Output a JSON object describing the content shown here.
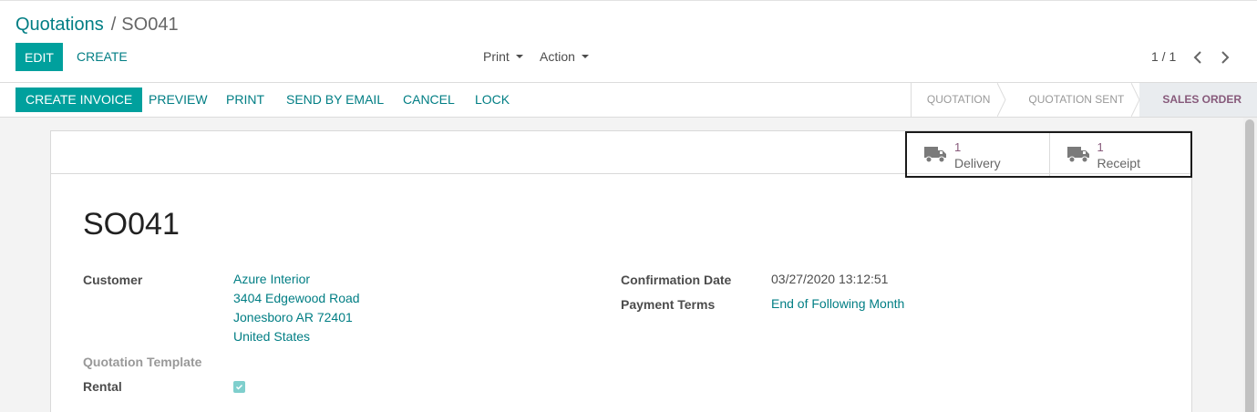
{
  "breadcrumb": {
    "parent": "Quotations",
    "separator": "/",
    "current": "SO041"
  },
  "toolbar": {
    "edit_label": "EDIT",
    "create_label": "CREATE",
    "print_label": "Print",
    "action_label": "Action"
  },
  "pager": {
    "value": "1 / 1"
  },
  "statusbar": {
    "buttons": [
      "CREATE INVOICE",
      "PREVIEW",
      "PRINT",
      "SEND BY EMAIL",
      "CANCEL",
      "LOCK"
    ],
    "stages": [
      "QUOTATION",
      "QUOTATION SENT",
      "SALES ORDER"
    ],
    "active_stage": "SALES ORDER"
  },
  "smart_buttons": [
    {
      "count": "1",
      "label": "Delivery",
      "icon": "truck-icon"
    },
    {
      "count": "1",
      "label": "Receipt",
      "icon": "truck-icon"
    }
  ],
  "form": {
    "title": "SO041",
    "customer_label": "Customer",
    "customer_lines": [
      "Azure Interior",
      "3404 Edgewood Road",
      "Jonesboro AR 72401",
      "United States"
    ],
    "quotation_template_label": "Quotation Template",
    "rental_label": "Rental",
    "rental_checked": true,
    "confirmation_date_label": "Confirmation Date",
    "confirmation_date": "03/27/2020 13:12:51",
    "payment_terms_label": "Payment Terms",
    "payment_terms": "End of Following Month"
  },
  "colors": {
    "primary": "#00a09d",
    "link": "#017e84",
    "accent": "#875a7b"
  }
}
